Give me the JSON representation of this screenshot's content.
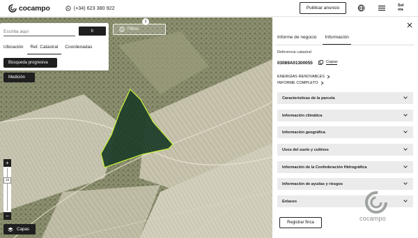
{
  "header": {
    "brand": "cocampo",
    "phone": "(+34) 623 380 922",
    "publish_label": "Publicar anuncio",
    "partner_line1": "Sol",
    "partner_line2": "via"
  },
  "map": {
    "search": {
      "placeholder": "Escriba aquí",
      "go_label": "Ir",
      "tabs": [
        "Ubicación",
        "Ref. Catastral",
        "Coordenadas"
      ],
      "active_tab": "Ref. Catastral"
    },
    "filters_label": "Filtros",
    "filters_count": "1",
    "busqueda_label": "Búsqueda progresiva",
    "medicion_label": "Medición",
    "zoom_plus": "+",
    "zoom_minus": "−",
    "zoom_level": "16",
    "layers_label": "Capas"
  },
  "panel": {
    "tabs": [
      "Informe de negocio",
      "Información"
    ],
    "active_tab": "Información",
    "ref_label": "Referencia catastral",
    "ref_value": "03089A01300055",
    "copy_label": "Copiar",
    "links": [
      "ENERGÍAS RENOVABLES",
      "INFORME COMPLETO"
    ],
    "sections": [
      "Características de la parcela",
      "Información climática",
      "Información geográfica",
      "Usos del suelo y cultivos",
      "Información de la Confederación Hidrográfica",
      "Información de ayudas y riesgos",
      "Enlaces"
    ],
    "register_label": "Registrar finca",
    "watermark": "cocampo"
  },
  "colors": {
    "accent_dark": "#1f1f1f",
    "parcel_fill": "#1e3d2a",
    "parcel_outline": "#c9f03a",
    "accordion_bg": "#ebebeb"
  },
  "icons": [
    "cocampo-logo-icon",
    "whatsapp-icon",
    "globe-icon",
    "menu-icon",
    "close-icon",
    "copy-icon",
    "chevron-right-icon",
    "chevron-down-icon",
    "filter-icon",
    "layers-icon"
  ]
}
